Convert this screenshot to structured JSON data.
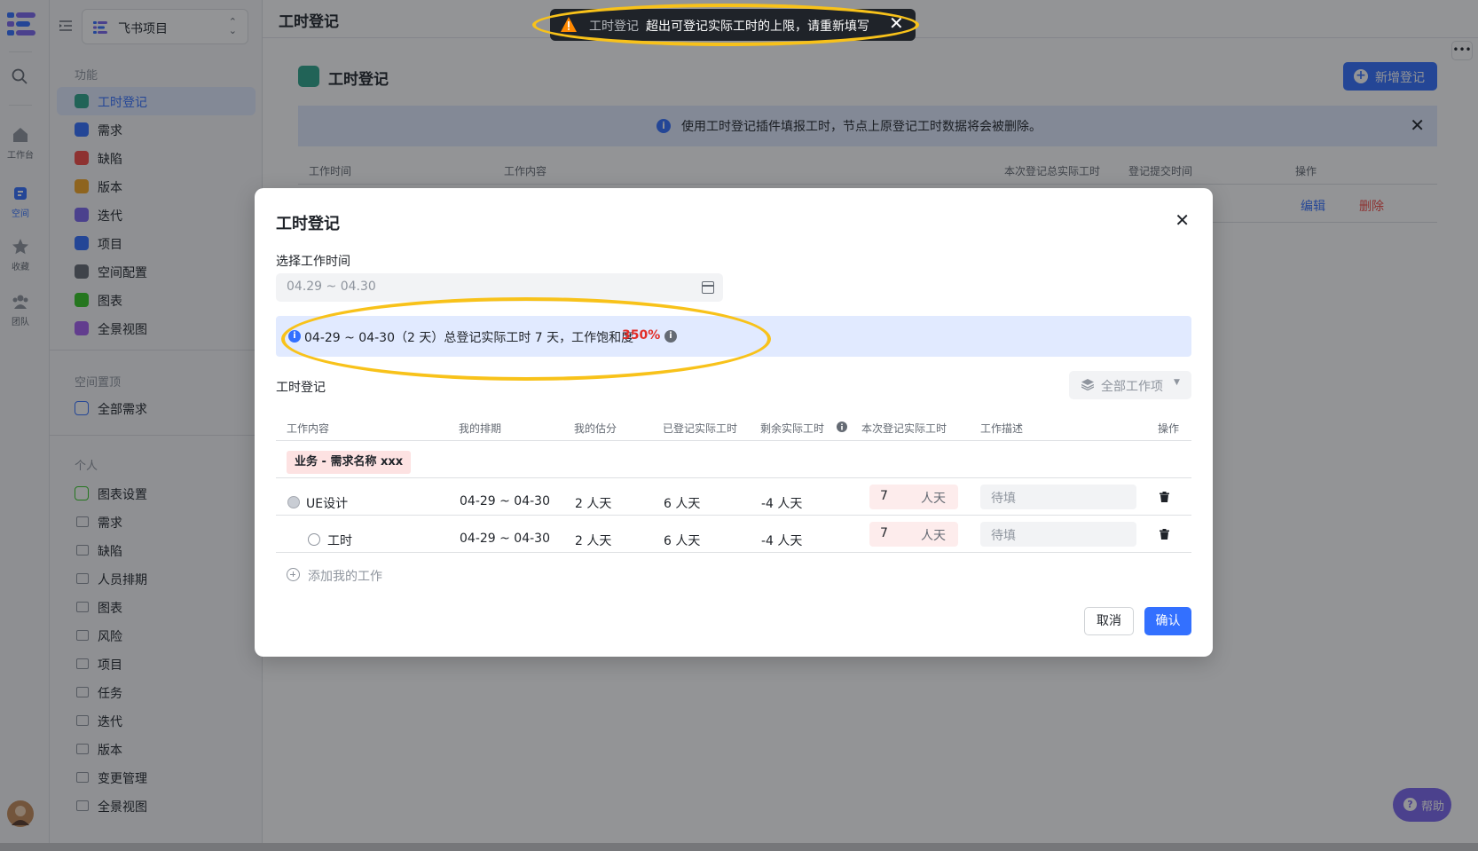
{
  "rail": {
    "items": [
      {
        "label": "工作台"
      },
      {
        "label": "空间"
      },
      {
        "label": "收藏"
      },
      {
        "label": "团队"
      }
    ]
  },
  "sidebar": {
    "project_name": "飞书项目",
    "section_function": "功能",
    "function_items": [
      {
        "label": "工时登记",
        "color": "#2ea58b"
      },
      {
        "label": "需求",
        "color": "#3370ff"
      },
      {
        "label": "缺陷",
        "color": "#f54a45"
      },
      {
        "label": "版本",
        "color": "#f5a623"
      },
      {
        "label": "迭代",
        "color": "#7b67ee"
      },
      {
        "label": "项目",
        "color": "#3370ff"
      },
      {
        "label": "空间配置",
        "color": "#646a73"
      },
      {
        "label": "图表",
        "color": "#34c724"
      },
      {
        "label": "全景视图",
        "color": "#a45ef0"
      }
    ],
    "section_pinned": "空间置顶",
    "pinned_items": [
      {
        "label": "全部需求"
      }
    ],
    "section_personal": "个人",
    "personal_items": [
      {
        "label": "图表设置"
      },
      {
        "label": "需求"
      },
      {
        "label": "缺陷"
      },
      {
        "label": "人员排期"
      },
      {
        "label": "图表"
      },
      {
        "label": "风险"
      },
      {
        "label": "项目"
      },
      {
        "label": "任务"
      },
      {
        "label": "迭代"
      },
      {
        "label": "版本"
      },
      {
        "label": "变更管理"
      },
      {
        "label": "全景视图"
      }
    ]
  },
  "main": {
    "topbar_title": "工时登记",
    "page_title": "工时登记",
    "new_button": "新增登记",
    "banner_text": "使用工时登记插件填报工时，节点上原登记工时数据将会被删除。",
    "columns": [
      "工作时间",
      "工作内容",
      "本次登记总实际工时",
      "登记提交时间",
      "操作"
    ],
    "row_actions": {
      "edit": "编辑",
      "delete": "删除"
    },
    "help": "帮助",
    "more": "•••"
  },
  "toast": {
    "title": "工时登记",
    "message": "超出可登记实际工时的上限，请重新填写"
  },
  "modal": {
    "title": "工时登记",
    "date_label": "选择工作时间",
    "date_value": "04.29 ~ 04.30",
    "info_text": "04-29 ~ 04-30（2 天）总登记实际工时 7 天，工作饱和度",
    "info_percent": "350%",
    "section_title": "工时登记",
    "filter_label": "全部工作项",
    "columns": [
      "工作内容",
      "我的排期",
      "我的估分",
      "已登记实际工时",
      "剩余实际工时",
      "本次登记实际工时",
      "工作描述",
      "操作"
    ],
    "group_tag": "业务 - 需求名称 xxx",
    "rows": [
      {
        "name": "UE设计",
        "schedule": "04-29 ~ 04-30",
        "estimate": "2 人天",
        "logged": "6 人天",
        "remaining": "-4 人天",
        "this_value": "7",
        "unit": "人天",
        "desc_placeholder": "待填"
      },
      {
        "name": "工时",
        "schedule": "04-29 ~ 04-30",
        "estimate": "2 人天",
        "logged": "6 人天",
        "remaining": "-4 人天",
        "this_value": "7",
        "unit": "人天",
        "desc_placeholder": "待填"
      }
    ],
    "add_work": "添加我的工作",
    "cancel": "取消",
    "confirm": "确认"
  }
}
